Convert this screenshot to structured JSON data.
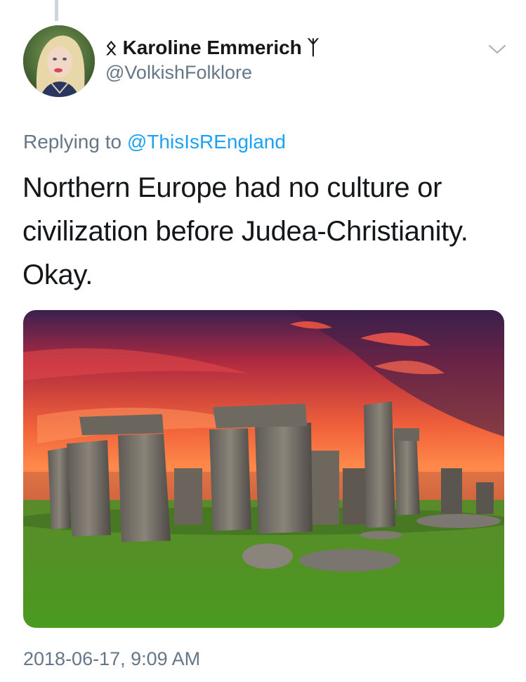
{
  "tweet": {
    "author_name": "ᛟ Karoline Emmerich ᛉ",
    "author_handle": "@VolkishFolklore",
    "replying_prefix": "Replying to ",
    "replying_to": "@ThisIsREngland",
    "text": "Northern Europe had no culture or civilization before Judea-Christianity. Okay.",
    "timestamp": "2018-06-17, 9:09 AM"
  },
  "icons": {
    "more": "chevron-down-icon"
  },
  "colors": {
    "link": "#1da1f2",
    "secondary_text": "#657786",
    "primary_text": "#14171a"
  }
}
